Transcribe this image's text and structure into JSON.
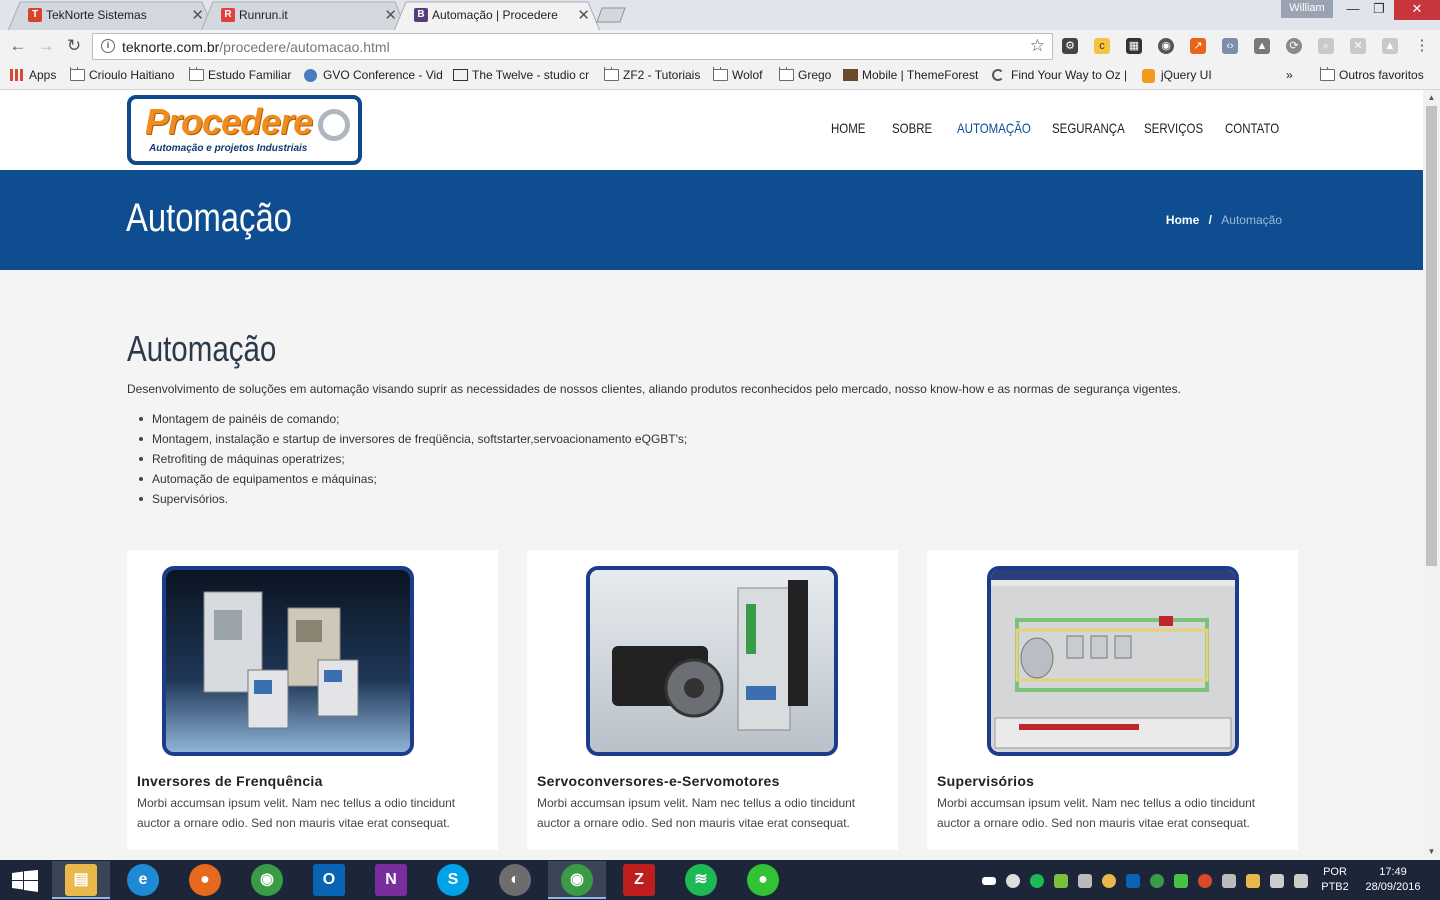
{
  "browser": {
    "tabs": [
      {
        "title": "TekNorte Sistemas",
        "icon": "teknorte-favicon",
        "color": "#d6452b",
        "glyph": "T"
      },
      {
        "title": "Runrun.it",
        "icon": "runrunit-favicon",
        "color": "#e0413a",
        "glyph": "R"
      },
      {
        "title": "Automação | Procedere",
        "icon": "bootstrap-favicon",
        "color": "#563d7c",
        "glyph": "B",
        "active": true
      }
    ],
    "profile_name": "William",
    "window_controls": {
      "minimize": "—",
      "restore": "❐",
      "close": "✕"
    },
    "url_domain": "teknorte.com.br",
    "url_path": "/procedere/automacao.html",
    "bookmarks": [
      {
        "label": "Apps",
        "icon": "apps-grid-icon"
      },
      {
        "label": "Crioulo Haitiano",
        "icon": "folder-icon"
      },
      {
        "label": "Estudo Familiar",
        "icon": "folder-icon"
      },
      {
        "label": "GVO Conference - Vid",
        "icon": "globe-icon"
      },
      {
        "label": "The Twelve - studio cr",
        "icon": "twelve-icon"
      },
      {
        "label": "ZF2 - Tutoriais",
        "icon": "folder-icon"
      },
      {
        "label": "Wolof",
        "icon": "folder-icon"
      },
      {
        "label": "Grego",
        "icon": "folder-icon"
      },
      {
        "label": "Mobile | ThemeForest",
        "icon": "themeforest-icon"
      },
      {
        "label": "Find Your Way to Oz |",
        "icon": "loading-icon"
      },
      {
        "label": "jQuery UI",
        "icon": "jquery-icon"
      }
    ],
    "bookmarks_overflow": "»",
    "other_bookmarks": "Outros favoritos"
  },
  "site": {
    "logo": {
      "name": "Procedere",
      "tagline": "Automação e projetos Industriais"
    },
    "nav": [
      {
        "label": "HOME"
      },
      {
        "label": "SOBRE"
      },
      {
        "label": "AUTOMAÇÃO",
        "active": true
      },
      {
        "label": "SEGURANÇA"
      },
      {
        "label": "SERVIÇOS"
      },
      {
        "label": "CONTATO"
      }
    ],
    "banner_title": "Automação",
    "breadcrumb": {
      "home": "Home",
      "separator": "/",
      "current": "Automação"
    },
    "content": {
      "title": "Automação",
      "intro": "Desenvolvimento de soluções em automação visando suprir as necessidades de nossos clientes, aliando produtos reconhecidos pelo mercado, nosso know-how e as normas de segurança vigentes.",
      "bullets": [
        "Montagem de painéis de comando;",
        "Montagem, instalação e startup de inversores de freqüência, softstarter,servoacionamento eQGBT's;",
        "Retrofiting de máquinas operatrizes;",
        "Automação de equipamentos e máquinas;",
        "Supervisórios."
      ]
    },
    "cards": [
      {
        "title": "Inversores de Frenquência",
        "text": "Morbi accumsan ipsum velit. Nam nec tellus a odio tincidunt auctor a ornare odio. Sed non mauris vitae erat consequat."
      },
      {
        "title": "Servoconversores-e-Servomotores",
        "text": "Morbi accumsan ipsum velit. Nam nec tellus a odio tincidunt auctor a ornare odio. Sed non mauris vitae erat consequat."
      },
      {
        "title": "Supervisórios",
        "text": "Morbi accumsan ipsum velit. Nam nec tellus a odio tincidunt auctor a ornare odio. Sed non mauris vitae erat consequat."
      }
    ]
  },
  "taskbar": {
    "apps": [
      {
        "name": "file-explorer",
        "color": "#e8b84a",
        "glyph": "▤"
      },
      {
        "name": "internet-explorer",
        "color": "#1e8ad6",
        "glyph": "e"
      },
      {
        "name": "firefox",
        "color": "#e66a1d",
        "glyph": "●"
      },
      {
        "name": "chrome",
        "color": "#3a9b46",
        "glyph": "◉"
      },
      {
        "name": "outlook",
        "color": "#0a64b4",
        "glyph": "O"
      },
      {
        "name": "onenote",
        "color": "#7a2d9c",
        "glyph": "N"
      },
      {
        "name": "skype",
        "color": "#00a3e8",
        "glyph": "S"
      },
      {
        "name": "thunderbird-like",
        "color": "#6d6d6d",
        "glyph": "◐"
      },
      {
        "name": "chrome-active",
        "color": "#3a9b46",
        "glyph": "◉"
      },
      {
        "name": "filezilla",
        "color": "#bf1e1e",
        "glyph": "Z"
      },
      {
        "name": "spotify",
        "color": "#1db954",
        "glyph": "≋"
      },
      {
        "name": "green-orb",
        "color": "#33c233",
        "glyph": "●"
      }
    ],
    "language": "POR",
    "keyboard": "PTB2",
    "time": "17:49",
    "date": "28/09/2016"
  }
}
